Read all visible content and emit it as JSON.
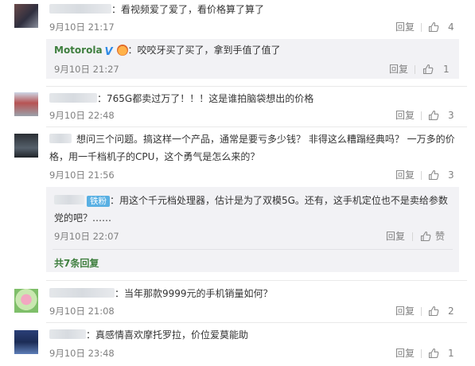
{
  "comments": [
    {
      "text": "：看视频爱了爱了，看价格算了算了",
      "time": "9月10日 21:17",
      "reply_label": "回复",
      "likes": "4"
    },
    {
      "text": "：765G都卖过万了！！！这是谁拍脑袋想出的价格",
      "time": "9月10日 22:48",
      "reply_label": "回复",
      "likes": "3"
    },
    {
      "text_line1": "想问三个问题。搞这样一个产品，通常是要亏多少钱？ 非得这么糟蹋经典吗？ 一万多的价",
      "text_line2": "格，用一千档机子的CPU，这个勇气是怎么来的？",
      "time": "9月10日 21:56",
      "reply_label": "回复",
      "likes": "3"
    },
    {
      "text": "：当年那款9999元的手机销量如何？",
      "time": "9月10日 21:08",
      "reply_label": "回复",
      "likes": "2"
    },
    {
      "text": "：真感情喜欢摩托罗拉，价位爱莫能助",
      "time": "9月10日 23:48",
      "reply_label": "回复",
      "likes": "1"
    }
  ],
  "reply1": {
    "username": "Motorola",
    "verified_mark": "V",
    "text": "：咬咬牙买了买了，拿到手值了值了",
    "time": "9月10日 21:27",
    "reply_label": "回复",
    "likes": "1"
  },
  "reply2": {
    "badge": "铁粉",
    "text_line1": "：用这个千元档处理器，估计是为了双模5G。还有，这手机定位也不是卖给参数",
    "text_line2": "党的吧？……",
    "time": "9月10日 22:07",
    "reply_label": "回复",
    "like_label": "赞",
    "more_replies": "共7条回复"
  },
  "colors": {
    "link_green": "#3f7f3f",
    "verified_blue": "#2e8ae6",
    "reply_bg": "#f2f2f5",
    "meta_gray": "#808080"
  },
  "icons": [
    "thumbs-up-icon",
    "verified-icon",
    "avatar"
  ]
}
